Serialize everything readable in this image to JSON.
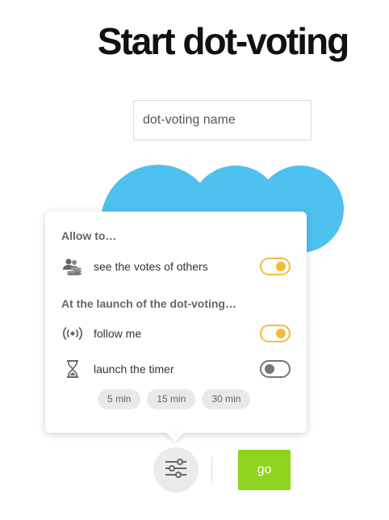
{
  "page": {
    "title": "Start dot-voting"
  },
  "name_input": {
    "placeholder": "dot-voting name",
    "value": ""
  },
  "popover": {
    "section_allow": "Allow to…",
    "allow_items": [
      {
        "icon": "users-coins-icon",
        "label": "see the votes of others",
        "enabled": true
      }
    ],
    "section_launch": "At the launch of the dot-voting…",
    "launch_items": [
      {
        "icon": "broadcast-icon",
        "label": "follow me",
        "enabled": true
      },
      {
        "icon": "hourglass-icon",
        "label": "launch the timer",
        "enabled": false
      }
    ],
    "timer_options": [
      "5 min",
      "15 min",
      "30 min"
    ]
  },
  "footer": {
    "settings_icon": "sliders-icon",
    "go_label": "go"
  },
  "colors": {
    "dot": "#4fc1ef",
    "toggle_on": "#f6b93b",
    "toggle_off": "#777777",
    "go_button": "#8fd31d"
  }
}
